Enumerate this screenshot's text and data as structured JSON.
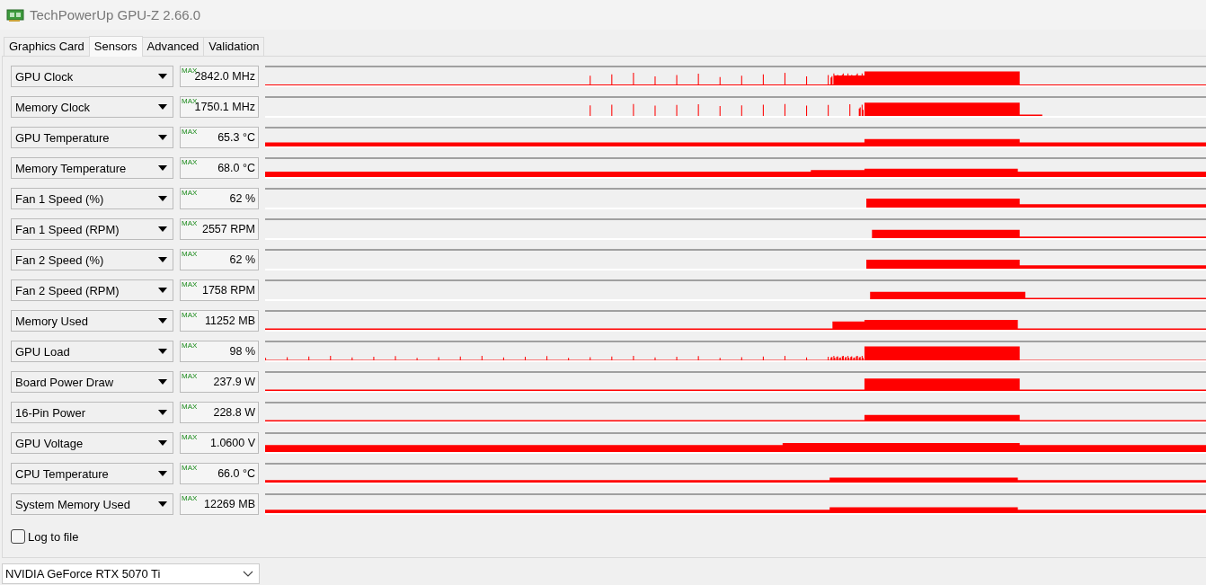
{
  "window": {
    "title": "TechPowerUp GPU-Z 2.66.0"
  },
  "tabs": [
    {
      "label": "Graphics Card",
      "selected": false
    },
    {
      "label": "Sensors",
      "selected": true
    },
    {
      "label": "Advanced",
      "selected": false
    },
    {
      "label": "Validation",
      "selected": false
    }
  ],
  "sensors": [
    {
      "name": "GPU Clock",
      "max_label": "MAX",
      "value": "2842.0 MHz"
    },
    {
      "name": "Memory Clock",
      "max_label": "MAX",
      "value": "1750.1 MHz"
    },
    {
      "name": "GPU Temperature",
      "max_label": "MAX",
      "value": "65.3 °C"
    },
    {
      "name": "Memory Temperature",
      "max_label": "MAX",
      "value": "68.0 °C"
    },
    {
      "name": "Fan 1 Speed (%)",
      "max_label": "MAX",
      "value": "62 %"
    },
    {
      "name": "Fan 1 Speed (RPM)",
      "max_label": "MAX",
      "value": "2557 RPM"
    },
    {
      "name": "Fan 2 Speed (%)",
      "max_label": "MAX",
      "value": "62 %"
    },
    {
      "name": "Fan 2 Speed (RPM)",
      "max_label": "MAX",
      "value": "1758 RPM"
    },
    {
      "name": "Memory Used",
      "max_label": "MAX",
      "value": "11252 MB"
    },
    {
      "name": "GPU Load",
      "max_label": "MAX",
      "value": "98 %"
    },
    {
      "name": "Board Power Draw",
      "max_label": "MAX",
      "value": "237.9 W"
    },
    {
      "name": "16-Pin Power",
      "max_label": "MAX",
      "value": "228.8 W"
    },
    {
      "name": "GPU Voltage",
      "max_label": "MAX",
      "value": "1.0600 V"
    },
    {
      "name": "CPU Temperature",
      "max_label": "MAX",
      "value": "66.0 °C"
    },
    {
      "name": "System Memory Used",
      "max_label": "MAX",
      "value": "12269 MB"
    }
  ],
  "log_to_file": {
    "label": "Log to file",
    "checked": false
  },
  "gpu_select": {
    "value": "NVIDIA GeForce RTX 5070 Ti"
  }
}
